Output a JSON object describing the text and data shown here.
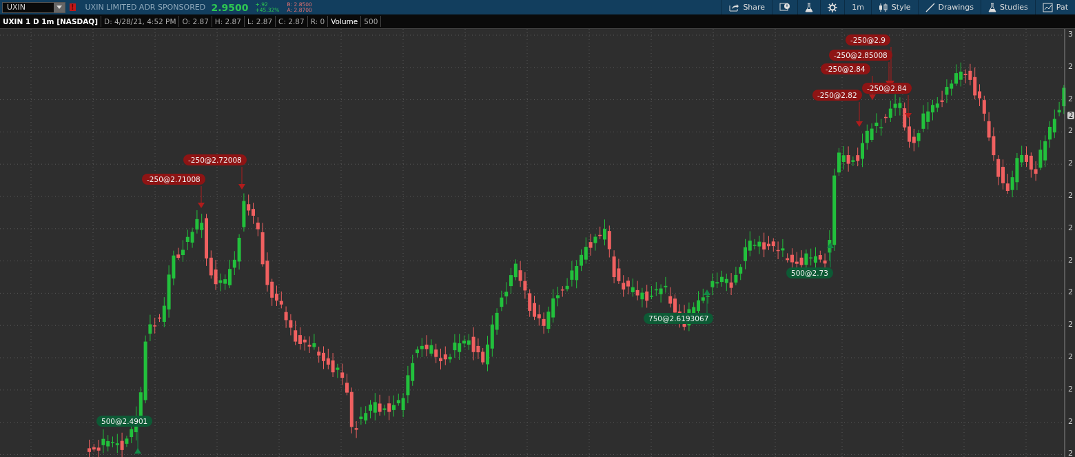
{
  "toolbar": {
    "symbol": "UXIN",
    "alert": "!",
    "company": "UXIN LIMITED ADR SPONSORED",
    "last": "2.9500",
    "change": "+.92",
    "change_pct": "+45.32%",
    "bid": "B: 2.8500",
    "ask": "A: 2.8700",
    "buttons": [
      {
        "kind": "share",
        "label": "Share"
      },
      {
        "kind": "alert"
      },
      {
        "kind": "flask"
      },
      {
        "kind": "gear"
      },
      {
        "kind": "text",
        "label": "1m"
      },
      {
        "kind": "style",
        "label": "Style"
      },
      {
        "kind": "drawings",
        "label": "Drawings"
      },
      {
        "kind": "studies",
        "label": "Studies"
      },
      {
        "kind": "patterns",
        "label": "Pat"
      }
    ]
  },
  "infobar": {
    "title": "UXIN 1 D 1m [NASDAQ]",
    "fields": [
      "D: 4/28/21, 4:52 PM",
      "O: 2.87",
      "H: 2.87",
      "L: 2.87",
      "C: 2.87",
      "R: 0"
    ],
    "volume_label": "Volume",
    "volume": "500"
  },
  "chart": {
    "axis_labels": [
      "3",
      "2",
      "2",
      "2",
      "2",
      "2",
      "2",
      "2",
      "2",
      "2",
      "2",
      "2",
      "2",
      "2"
    ],
    "price_tag": "2",
    "orders": [
      {
        "kind": "sell",
        "label": "-250@2.9"
      },
      {
        "kind": "sell",
        "label": "-250@2.85008"
      },
      {
        "kind": "sell",
        "label": "-250@2.84"
      },
      {
        "kind": "sell",
        "label": "-250@2.84"
      },
      {
        "kind": "sell",
        "label": "-250@2.82"
      },
      {
        "kind": "sell",
        "label": "-250@2.72008"
      },
      {
        "kind": "sell",
        "label": "-250@2.71008"
      },
      {
        "kind": "buy",
        "label": "500@2.73"
      },
      {
        "kind": "buy",
        "label": "750@2.6193067"
      },
      {
        "kind": "buy",
        "label": "500@2.4901"
      }
    ]
  }
}
